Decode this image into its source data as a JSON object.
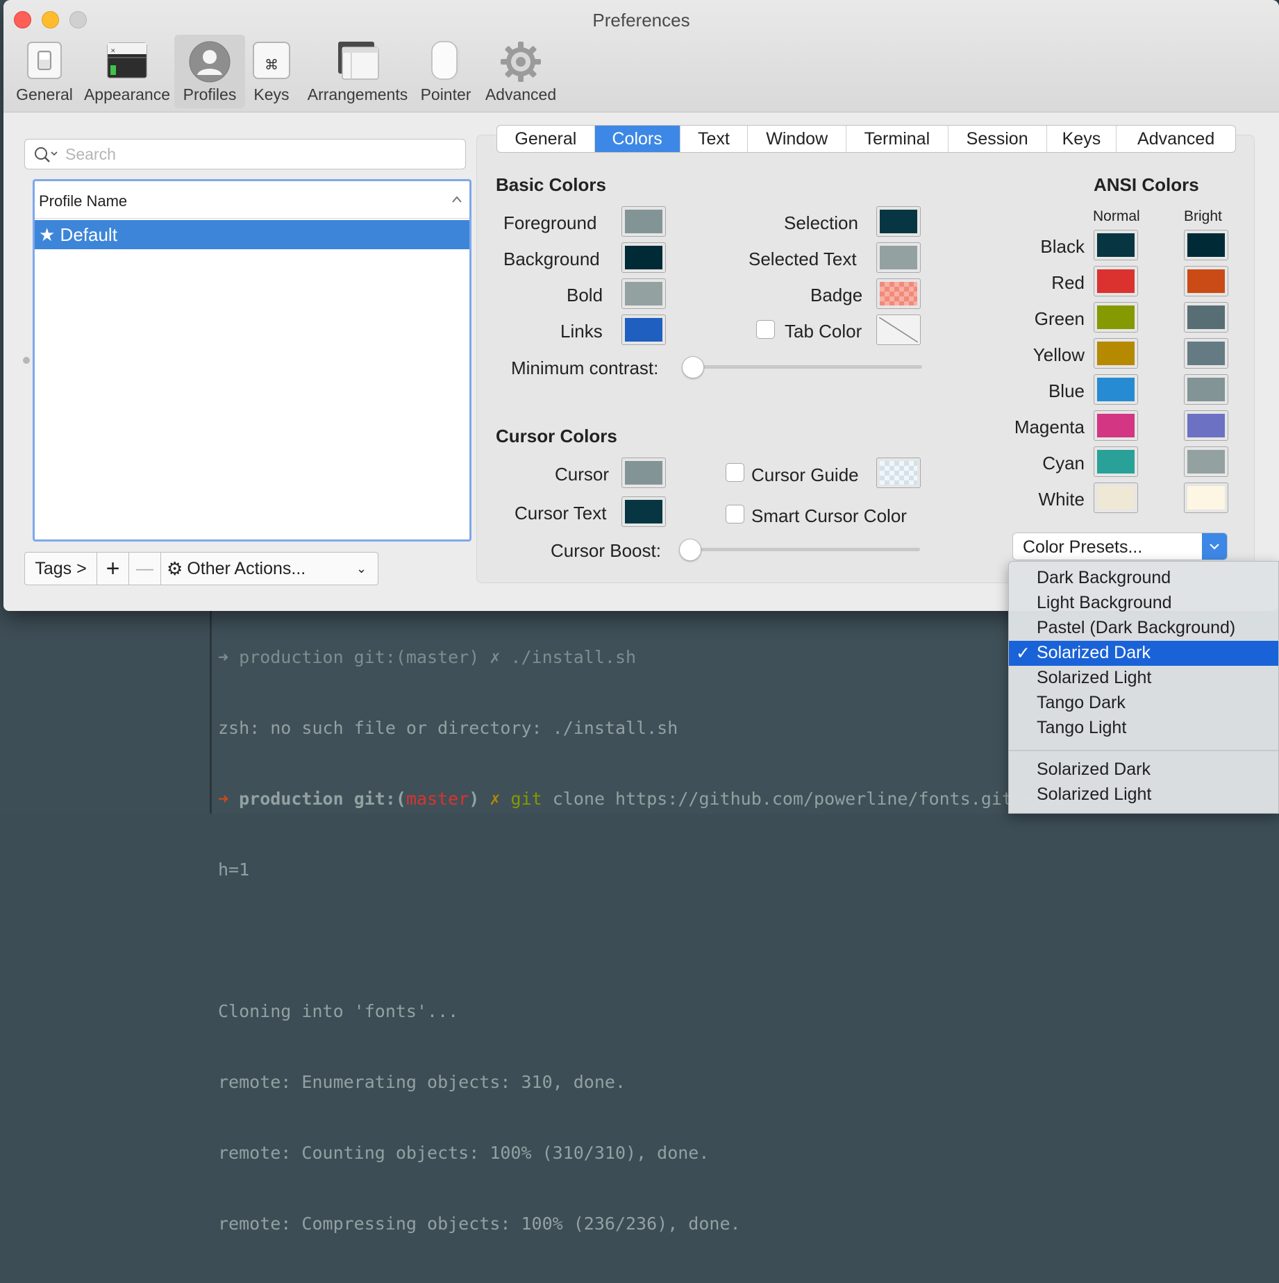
{
  "terminal": {
    "lines": [
      {
        "kind": "prompt_partial",
        "text": "➜ production git:(master) ✗ ./install.sh"
      },
      {
        "kind": "plain",
        "text": "zsh: no such file or directory: ./install.sh"
      },
      {
        "kind": "prompt",
        "arrow": "➜",
        "dir": "production",
        "git": "git:(",
        "branch": "master",
        "git_close": ")",
        "x": "✗",
        "cmd": "git",
        "rest": " clone https://github.com/powerline/fonts.git --de"
      },
      {
        "kind": "plain",
        "text": "h=1"
      },
      {
        "kind": "plain",
        "text": ""
      },
      {
        "kind": "plain",
        "text": "Cloning into 'fonts'..."
      },
      {
        "kind": "plain",
        "text": "remote: Enumerating objects: 310, done."
      },
      {
        "kind": "plain",
        "text": "remote: Counting objects: 100% (310/310), done."
      },
      {
        "kind": "plain",
        "text": "remote: Compressing objects: 100% (236/236), done."
      }
    ]
  },
  "window": {
    "title": "Preferences",
    "toolbar": [
      {
        "id": "general",
        "label": "General",
        "icon": "switch-icon"
      },
      {
        "id": "appearance",
        "label": "Appearance",
        "icon": "window-icon"
      },
      {
        "id": "profiles",
        "label": "Profiles",
        "icon": "person-icon",
        "selected": true
      },
      {
        "id": "keys",
        "label": "Keys",
        "icon": "command-key-icon"
      },
      {
        "id": "arrangements",
        "label": "Arrangements",
        "icon": "windows-stack-icon"
      },
      {
        "id": "pointer",
        "label": "Pointer",
        "icon": "mouse-icon"
      },
      {
        "id": "advanced",
        "label": "Advanced",
        "icon": "gear-icon"
      }
    ]
  },
  "profiles_panel": {
    "search_placeholder": "Search",
    "column_header": "Profile Name",
    "profiles": [
      {
        "name": "Default",
        "selected": true,
        "default": true
      }
    ],
    "tags_label": "Tags >",
    "add_label": "+",
    "remove_label": "—",
    "other_actions_label": "Other Actions..."
  },
  "tabs": [
    {
      "label": "General"
    },
    {
      "label": "Colors",
      "active": true
    },
    {
      "label": "Text"
    },
    {
      "label": "Window"
    },
    {
      "label": "Terminal"
    },
    {
      "label": "Session"
    },
    {
      "label": "Keys"
    },
    {
      "label": "Advanced"
    }
  ],
  "basic_colors": {
    "title": "Basic Colors",
    "foreground": {
      "label": "Foreground",
      "color": "#839496"
    },
    "background": {
      "label": "Background",
      "color": "#002b36"
    },
    "bold": {
      "label": "Bold",
      "color": "#93a1a1"
    },
    "links": {
      "label": "Links",
      "color": "#1f5fbf"
    },
    "selection": {
      "label": "Selection",
      "color": "#073642"
    },
    "selected_text": {
      "label": "Selected Text",
      "color": "#93a1a1"
    },
    "badge": {
      "label": "Badge",
      "color": "#f28a7a"
    },
    "tab_color": {
      "label": "Tab Color",
      "checked": false
    },
    "minimum_contrast": {
      "label": "Minimum contrast:",
      "value": 0
    }
  },
  "cursor_colors": {
    "title": "Cursor Colors",
    "cursor": {
      "label": "Cursor",
      "color": "#839496"
    },
    "cursor_text": {
      "label": "Cursor Text",
      "color": "#073642"
    },
    "cursor_guide": {
      "label": "Cursor Guide",
      "checked": false
    },
    "smart_cursor": {
      "label": "Smart Cursor Color",
      "checked": false
    },
    "cursor_boost": {
      "label": "Cursor Boost:",
      "value": 0
    }
  },
  "ansi_colors": {
    "title": "ANSI Colors",
    "normal_header": "Normal",
    "bright_header": "Bright",
    "rows": [
      {
        "name": "Black",
        "normal": "#073642",
        "bright": "#002b36"
      },
      {
        "name": "Red",
        "normal": "#dc322f",
        "bright": "#cb4b16"
      },
      {
        "name": "Green",
        "normal": "#859900",
        "bright": "#586e75"
      },
      {
        "name": "Yellow",
        "normal": "#b58900",
        "bright": "#657b83"
      },
      {
        "name": "Blue",
        "normal": "#268bd2",
        "bright": "#839496"
      },
      {
        "name": "Magenta",
        "normal": "#d33682",
        "bright": "#6c71c4"
      },
      {
        "name": "Cyan",
        "normal": "#2aa198",
        "bright": "#93a1a1"
      },
      {
        "name": "White",
        "normal": "#eee8d5",
        "bright": "#fdf6e3"
      }
    ]
  },
  "color_presets": {
    "button_label": "Color Presets...",
    "menu_items": [
      {
        "label": "Dark Background"
      },
      {
        "label": "Light Background"
      },
      {
        "label": "Pastel (Dark Background)"
      },
      {
        "label": "Solarized Dark",
        "checked": true,
        "highlighted": true
      },
      {
        "label": "Solarized Light"
      },
      {
        "label": "Tango Dark"
      },
      {
        "label": "Tango Light"
      },
      {
        "label": "Solarized Dark",
        "group": 2
      },
      {
        "label": "Solarized Light",
        "group": 2
      }
    ]
  }
}
